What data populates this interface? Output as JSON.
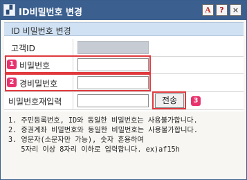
{
  "window": {
    "title": "ID비밀번호 변경",
    "icon": "app-logo-icon",
    "controls": {
      "font_label": "A",
      "help_label": "?",
      "close_label": "×"
    }
  },
  "panel": {
    "title": "ID 비밀번호 변경",
    "rows": [
      {
        "label": "고객ID",
        "value": ""
      },
      {
        "badge": "1",
        "label": "비밀번호",
        "value": ""
      },
      {
        "badge": "2",
        "label": "경비밀번호",
        "value": ""
      },
      {
        "label": "비밀번호재입력",
        "value": ""
      }
    ],
    "confirm_button": "전송",
    "confirm_badge": "3"
  },
  "notes": [
    "1. 주민등록번호, ID와 동일한 비밀번호는 사용불가합니다.",
    "2. 증권계좌 비밀번호와 동일한 비밀번호는 사용불가합니다.",
    "3. 영문자(소문자만 가능), 숫자 혼용하여",
    "   5자리 이상 8자리 이하로 입력합니다. ex)af15h"
  ],
  "colors": {
    "titlebar": "#3b5f8e",
    "panel_header": "#cfe1f3",
    "highlight_border": "#e0393e",
    "badge": "#e8326e"
  }
}
